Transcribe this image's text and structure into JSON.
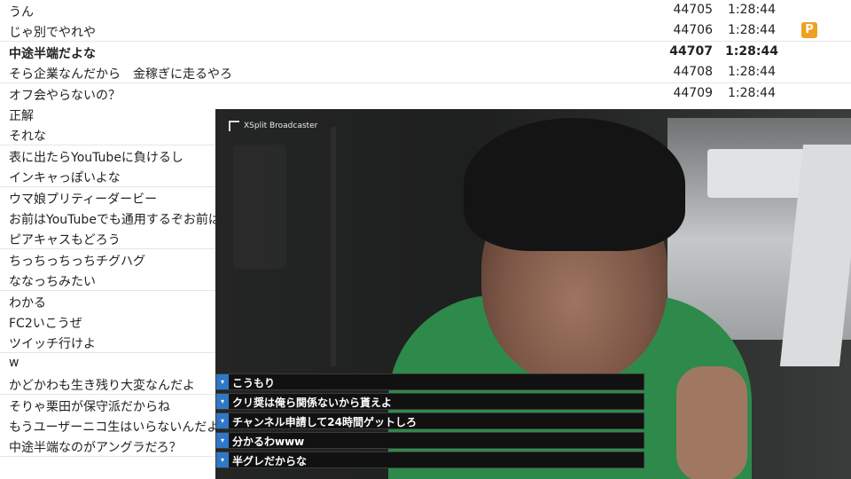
{
  "comments": [
    {
      "text": "うん",
      "no": "44705",
      "time": "1:28:44"
    },
    {
      "text": "じゃ別でやれや",
      "no": "44706",
      "time": "1:28:44",
      "badge": "P"
    },
    {
      "text": "中途半端だよな",
      "no": "44707",
      "time": "1:28:44",
      "bold": true
    },
    {
      "text": "そら企業なんだから　金稼ぎに走るやろ",
      "no": "44708",
      "time": "1:28:44"
    },
    {
      "text": "オフ会やらないの？",
      "no": "44709",
      "time": "1:28:44"
    },
    {
      "text": "正解"
    },
    {
      "text": "それな"
    },
    {
      "text": "表に出たらYouTubeに負けるし"
    },
    {
      "text": "インキャっぽいよな"
    },
    {
      "text": "ウマ娘プリティーダービー"
    },
    {
      "text": "お前はYouTubeでも通用するぞお前は"
    },
    {
      "text": "ピアキャスもどろう"
    },
    {
      "text": "ちっちっちっちチグハグ"
    },
    {
      "text": "ななっちみたい"
    },
    {
      "text": "わかる"
    },
    {
      "text": "FC2いこうぜ"
    },
    {
      "text": "ツイッチ行けよ"
    },
    {
      "text": "w"
    },
    {
      "text": "かどかわも生き残り大変なんだよ"
    },
    {
      "text": "そりゃ栗田が保守派だからね"
    },
    {
      "text": "もうユーザーニコ生はいらないんだよ"
    },
    {
      "text": "中途半端なのがアングラだろ？"
    }
  ],
  "video": {
    "brand": "XSplit Broadcaster",
    "overlay_comments": [
      "こうもり",
      "クリ奨は俺ら関係ないから貰えよ",
      "チャンネル申請して24時間ゲットしろ",
      "分かるわwww",
      "半グレだからな"
    ]
  },
  "colors": {
    "badge": "#f0a020",
    "overlay_icon": "#2f78c8",
    "shirt": "#2e8a4a"
  },
  "icons": {
    "overlay_icon": "comment-icon",
    "badge": "premium-badge-icon"
  }
}
